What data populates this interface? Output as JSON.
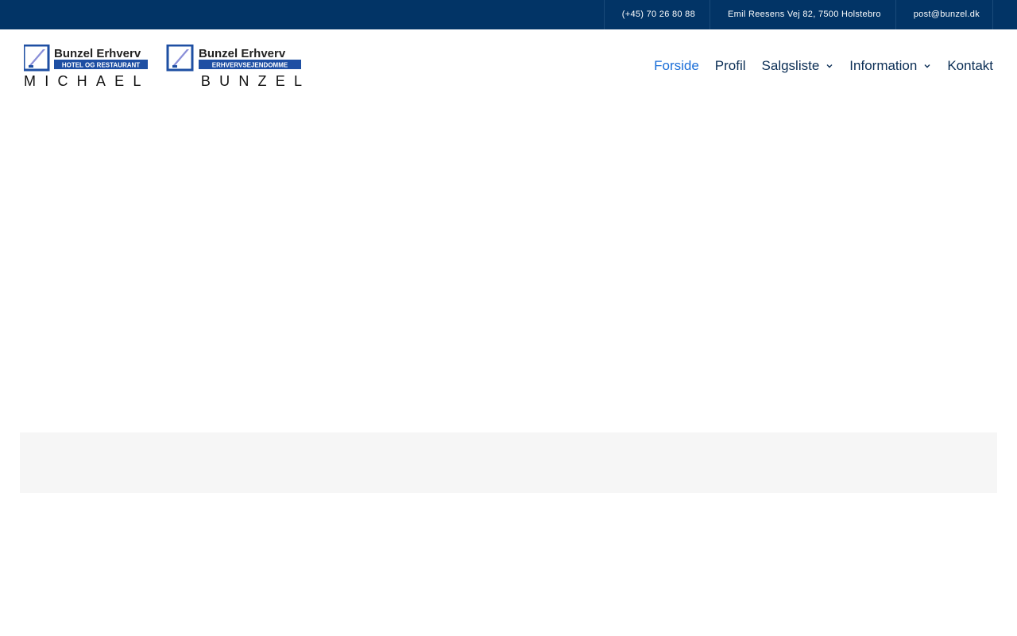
{
  "topbar": {
    "phone": "(+45) 70 26 80 88",
    "address": "Emil Reesens Vej 82, 7500 Holstebro",
    "email": "post@bunzel.dk"
  },
  "logo": {
    "left_title": "Bunzel Erhverv",
    "left_subtitle": "HOTEL OG RESTAURANT",
    "right_title": "Bunzel Erhverv",
    "right_subtitle": "ERHVERVSEJENDOMME",
    "name": "MICHAEL    BUNZEL"
  },
  "nav": {
    "items": [
      {
        "label": "Forside"
      },
      {
        "label": "Profil"
      },
      {
        "label": "Salgsliste"
      },
      {
        "label": "Information"
      },
      {
        "label": "Kontakt"
      }
    ]
  },
  "colors": {
    "topbar": "#023466",
    "nav_text": "#0b2e55",
    "nav_active": "#1a6ed8",
    "logo_blue": "#1e4fa3",
    "band": "#f6f6f6"
  }
}
